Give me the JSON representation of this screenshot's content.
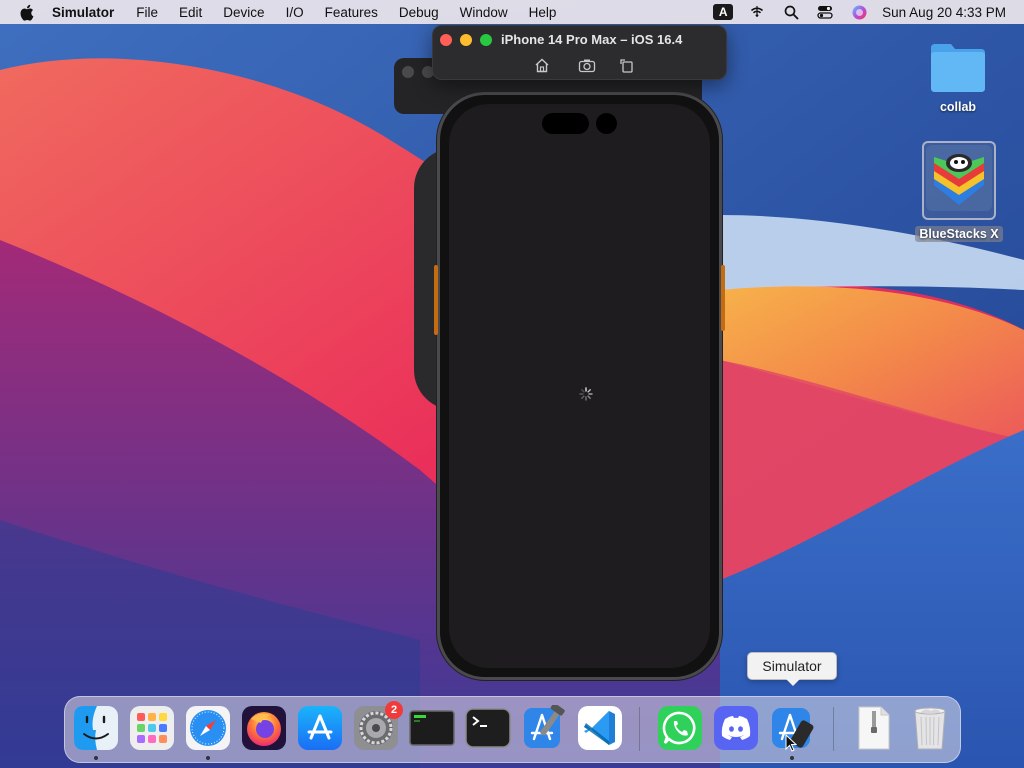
{
  "menubar": {
    "app_name": "Simulator",
    "items": [
      "File",
      "Edit",
      "Device",
      "I/O",
      "Features",
      "Debug",
      "Window",
      "Help"
    ],
    "input_source": "A",
    "clock": "Sun Aug 20  4:33 PM"
  },
  "simulator_window": {
    "title": "iPhone 14 Pro Max – iOS 16.4",
    "buttons": [
      "home-icon",
      "screenshot-icon",
      "rotate-icon"
    ]
  },
  "desktop_icons": [
    {
      "label": "collab",
      "icon": "folder-icon"
    },
    {
      "label": "BlueStacks X",
      "icon": "bluestacks-icon"
    }
  ],
  "tooltip": "Simulator",
  "dock": {
    "items": [
      {
        "name": "finder-icon",
        "running": true
      },
      {
        "name": "launchpad-icon",
        "running": false
      },
      {
        "name": "safari-icon",
        "running": true
      },
      {
        "name": "firefox-icon",
        "running": false
      },
      {
        "name": "app-store-icon",
        "running": false
      },
      {
        "name": "system-settings-icon",
        "running": false,
        "badge": "2"
      },
      {
        "name": "script-editor-icon",
        "running": false
      },
      {
        "name": "terminal-icon",
        "running": false
      },
      {
        "name": "xcode-icon",
        "running": false
      },
      {
        "name": "vscode-icon",
        "running": false
      },
      {
        "name": "whatsapp-icon",
        "running": false
      },
      {
        "name": "discord-icon",
        "running": false
      },
      {
        "name": "simulator-icon",
        "running": true
      },
      {
        "name": "archive-file-icon",
        "running": false
      },
      {
        "name": "trash-icon",
        "running": false
      }
    ]
  },
  "colors": {
    "menubar": "#ece6ec",
    "phone_screen": "#1e1c1e",
    "badge": "#f13b3b"
  }
}
